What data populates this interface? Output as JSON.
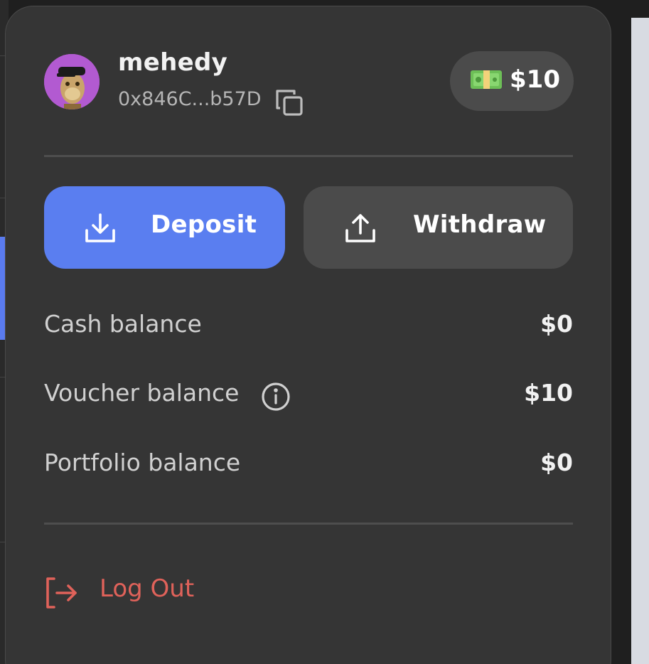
{
  "profile": {
    "username": "mehedy",
    "address": "0x846C...b57D",
    "avatar_icon": "ape-avatar-icon"
  },
  "balance_badge": {
    "icon": "money-icon",
    "amount": "$10"
  },
  "actions": {
    "deposit_label": "Deposit",
    "withdraw_label": "Withdraw"
  },
  "balances": [
    {
      "label": "Cash balance",
      "value": "$0"
    },
    {
      "label": "Voucher balance",
      "value": "$10",
      "has_info": true
    },
    {
      "label": "Portfolio balance",
      "value": "$0"
    }
  ],
  "logout": {
    "label": "Log Out"
  },
  "colors": {
    "panel": "#353535",
    "deposit": "#5a7ef0",
    "withdraw": "#4b4b4b",
    "logout": "#e0625a"
  }
}
